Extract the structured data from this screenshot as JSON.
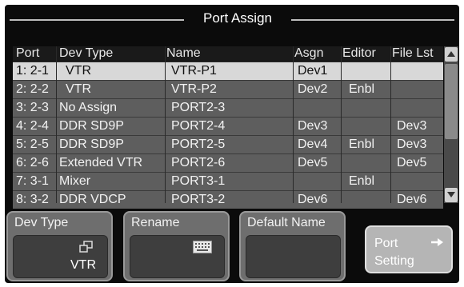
{
  "title": "Port Assign",
  "columns": {
    "port": "Port",
    "dev_type": "Dev Type",
    "name": "Name",
    "asgn": "Asgn",
    "editor": "Editor",
    "file_lst": "File Lst"
  },
  "rows": [
    {
      "port": "1: 2-1",
      "dev_type": "VTR",
      "name": "VTR-P1",
      "asgn": "Dev1",
      "editor": "",
      "file_lst": ""
    },
    {
      "port": "2: 2-2",
      "dev_type": "VTR",
      "name": "VTR-P2",
      "asgn": "Dev2",
      "editor": "Enbl",
      "file_lst": ""
    },
    {
      "port": "3: 2-3",
      "dev_type": "No Assign",
      "name": "PORT2-3",
      "asgn": "",
      "editor": "",
      "file_lst": ""
    },
    {
      "port": "4: 2-4",
      "dev_type": "DDR SD9P",
      "name": "PORT2-4",
      "asgn": "Dev3",
      "editor": "",
      "file_lst": "Dev3"
    },
    {
      "port": "5: 2-5",
      "dev_type": "DDR SD9P",
      "name": "PORT2-5",
      "asgn": "Dev4",
      "editor": "Enbl",
      "file_lst": "Dev3"
    },
    {
      "port": "6: 2-6",
      "dev_type": "Extended VTR",
      "name": "PORT2-6",
      "asgn": "Dev5",
      "editor": "",
      "file_lst": "Dev5"
    },
    {
      "port": "7: 3-1",
      "dev_type": "Mixer",
      "name": "PORT3-1",
      "asgn": "",
      "editor": "Enbl",
      "file_lst": ""
    },
    {
      "port": "8: 3-2",
      "dev_type": "DDR VDCP",
      "name": "PORT3-2",
      "asgn": "Dev6",
      "editor": "",
      "file_lst": "Dev6"
    }
  ],
  "selected_row": 0,
  "buttons": {
    "dev_type_label": "Dev Type",
    "dev_type_value": "VTR",
    "rename_label": "Rename",
    "default_name_label": "Default Name",
    "port_setting_line1": "Port",
    "port_setting_line2": "Setting"
  },
  "colors": {
    "background": "#0b0b0b",
    "row": "#5e5e5e",
    "selected_row": "#d8d8d8",
    "button": "#6e6e6e"
  },
  "icons": {
    "dev_type": "window-stack-icon",
    "rename": "keyboard-icon",
    "port_setting": "arrow-right-icon",
    "scroll_up": "triangle-up-icon",
    "scroll_down": "triangle-down-icon"
  }
}
